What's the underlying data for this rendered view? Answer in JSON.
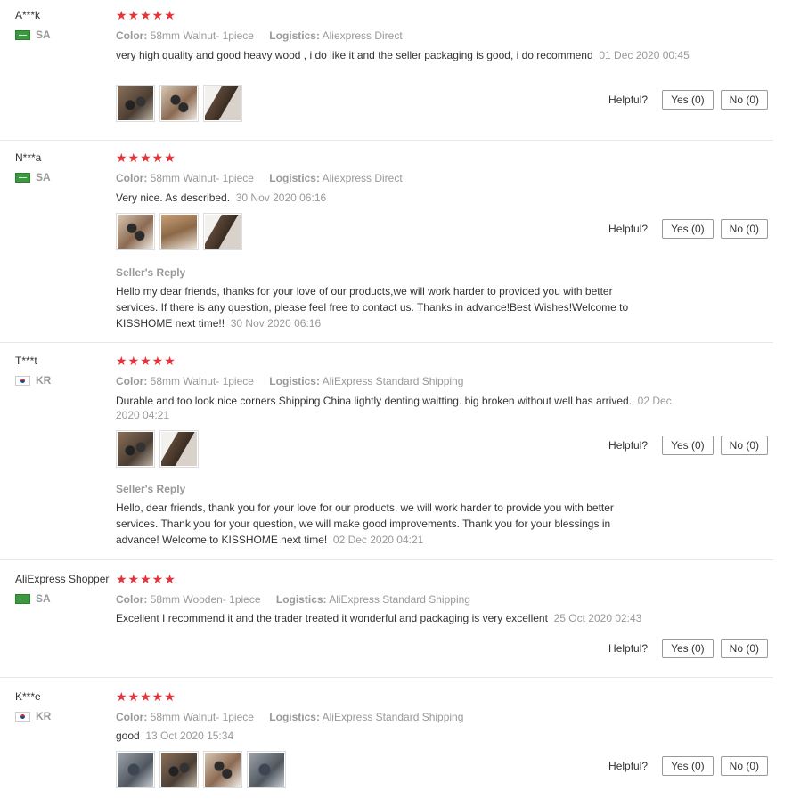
{
  "labels": {
    "color": "Color:",
    "logistics": "Logistics:",
    "helpful": "Helpful?",
    "yes": "Yes (0)",
    "no": "No (0)",
    "seller_reply": "Seller's Reply"
  },
  "stars": "★★★★★",
  "reviews": [
    {
      "user": "A***k",
      "country": "SA",
      "flag": "sa-flag-icon",
      "rating": 5,
      "color": "58mm Walnut- 1piece",
      "logistics": "Aliexpress Direct",
      "text": "very high quality and good heavy wood , i do like it and the seller packaging is good, i do recommend",
      "date": "01 Dec 2020 00:45",
      "photos": [
        "review-photo-1",
        "review-photo-2",
        "review-photo-3"
      ],
      "helpful_yes": "Yes (0)",
      "helpful_no": "No (0)"
    },
    {
      "user": "N***a",
      "country": "SA",
      "flag": "sa-flag-icon",
      "rating": 5,
      "color": "58mm Walnut- 1piece",
      "logistics": "Aliexpress Direct",
      "text": "Very nice. As described.",
      "date": "30 Nov 2020 06:16",
      "photos": [
        "review-photo-1",
        "review-photo-2",
        "review-photo-3"
      ],
      "helpful_yes": "Yes (0)",
      "helpful_no": "No (0)",
      "seller_reply": {
        "text": "Hello my dear friends, thanks for your love of our products,we will work harder to provided you with better services. If there is any question, please feel free to contact us. Thanks in advance!Best Wishes!Welcome to KISSHOME next time!!",
        "date": "30 Nov 2020 06:16"
      }
    },
    {
      "user": "T***t",
      "country": "KR",
      "flag": "kr-flag-icon",
      "rating": 5,
      "color": "58mm Walnut- 1piece",
      "logistics": "AliExpress Standard Shipping",
      "text": "Durable and too look nice corners Shipping China lightly denting waitting. big broken without well has arrived.",
      "date": "02 Dec 2020 04:21",
      "photos": [
        "review-photo-1",
        "review-photo-2"
      ],
      "helpful_yes": "Yes (0)",
      "helpful_no": "No (0)",
      "seller_reply": {
        "text": "Hello, dear friends, thank you for your love for our products, we will work harder to provide you with better services. Thank you for your question, we will make good improvements. Thank you for your blessings in advance! Welcome to KISSHOME next time!",
        "date": "02 Dec 2020 04:21"
      }
    },
    {
      "user": "AliExpress Shopper",
      "country": "SA",
      "flag": "sa-flag-icon",
      "rating": 5,
      "color": "58mm Wooden- 1piece",
      "logistics": "AliExpress Standard Shipping",
      "text": "Excellent I recommend it and the trader treated it wonderful and packaging is very excellent",
      "date": "25 Oct 2020 02:43",
      "photos": [],
      "helpful_yes": "Yes (0)",
      "helpful_no": "No (0)"
    },
    {
      "user": "K***e",
      "country": "KR",
      "flag": "kr-flag-icon",
      "rating": 5,
      "color": "58mm Walnut- 1piece",
      "logistics": "AliExpress Standard Shipping",
      "text": "good",
      "date": "13 Oct 2020 15:34",
      "photos": [
        "review-photo-1",
        "review-photo-2",
        "review-photo-3",
        "review-photo-4"
      ],
      "helpful_yes": "Yes (0)",
      "helpful_no": "No (0)"
    }
  ]
}
